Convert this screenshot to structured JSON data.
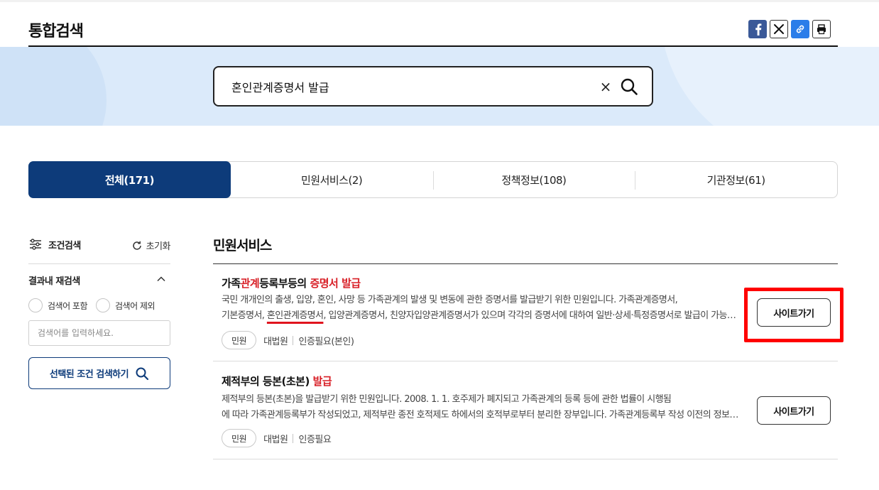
{
  "header": {
    "title": "통합검색",
    "share_icons": [
      "facebook-icon",
      "x-icon",
      "link-icon",
      "print-icon"
    ]
  },
  "search": {
    "query": "혼인관계증명서 발급",
    "clear_label": "×"
  },
  "tabs": [
    {
      "label": "전체(171)",
      "active": true
    },
    {
      "label": "민원서비스(2)",
      "active": false
    },
    {
      "label": "정책정보(108)",
      "active": false
    },
    {
      "label": "기관정보(61)",
      "active": false
    }
  ],
  "filter": {
    "title": "조건검색",
    "reset_label": "초기화",
    "refine_title": "결과내 재검색",
    "include_label": "검색어 포함",
    "exclude_label": "검색어 제외",
    "input_placeholder": "검색어를 입력하세요.",
    "submit_label": "선택된 조건 검색하기"
  },
  "results": {
    "section_title": "민원서비스",
    "items": [
      {
        "title_parts": [
          "가족",
          "관계",
          "등록부등의 ",
          "증명서 발급"
        ],
        "desc_line1": "국민 개개인의 출생, 입양, 혼인, 사망 등 가족관계의 발생 및 변동에 관한 증명서를 발급받기 위한 민원입니다. 가족관계증명서,",
        "desc_line2_before": "기본증명서, ",
        "desc_line2_underlined": "혼인관계증명서",
        "desc_line2_after": ", 입양관계증명서, 친양자입양관계증명서가 있으며 각각의 증명서에 대하여 일반·상세·특정증명서로 발급이 가능합니다.",
        "tag": "민원",
        "agency": "대법원",
        "auth": "인증필요(본인)",
        "button": "사이트가기"
      },
      {
        "title_parts": [
          "제적부의 등본(초본) ",
          "발급"
        ],
        "desc_line1": "제적부의 등본(초본)을 발급받기 위한 민원입니다. 2008. 1. 1. 호주제가 폐지되고 가족관계의 등록 등에 관한 법률이 시행됨",
        "desc_line2": "에 따라 가족관계등록부가 작성되었고, 제적부란 종전 호적제도 하에서의 호적부로부터 분리한 장부입니다. 가족관계등록부 작성 이전의 정보를 확인할 수 있습니다.",
        "tag": "민원",
        "agency": "대법원",
        "auth": "인증필요",
        "button": "사이트가기"
      }
    ]
  },
  "colors": {
    "primary": "#0d3b7a",
    "highlight": "#d81f26",
    "annotation": "#ff0000",
    "band": "#dbeafa"
  }
}
